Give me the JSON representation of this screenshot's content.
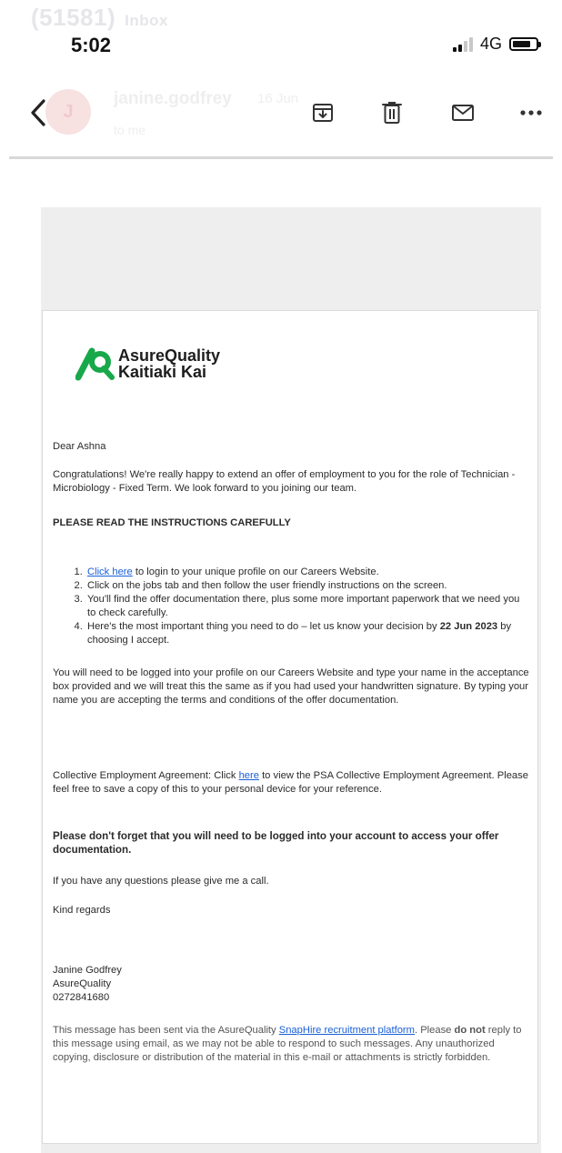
{
  "background_header": {
    "inbox_count": "(51581)",
    "inbox_label": "Inbox",
    "sender_initials": "J",
    "sender_name": "janine.godfrey",
    "date": "16 Jun",
    "to_line": "to me"
  },
  "status_bar": {
    "time": "5:02",
    "network": "4G"
  },
  "toolbar": {
    "back_icon": "chevron-left-icon",
    "archive_icon": "archive-icon",
    "delete_icon": "trash-icon",
    "mark_unread_icon": "envelope-icon",
    "more_icon": "ellipsis-icon"
  },
  "email": {
    "logo_line1": "AsureQuality",
    "logo_line2": "Kaitiaki Kai",
    "greeting": "Dear Ashna",
    "intro": "Congratulations! We're really happy to extend an offer of employment to you for the role of Technician - Microbiology - Fixed Term. We look forward to you joining our team.",
    "instructions_heading": "PLEASE READ THE INSTRUCTIONS CAREFULLY",
    "steps": {
      "s1_link": "Click here",
      "s1_rest": " to login to your unique profile on our Careers Website.",
      "s2": "Click on the jobs tab and then follow the user friendly instructions on the screen.",
      "s3": "You'll find the offer documentation there, plus some more important paperwork that we need you to check carefully.",
      "s4_pre": "Here's the most important thing you need to do – let us know your decision by ",
      "s4_date": "22 Jun 2023",
      "s4_post": " by choosing I accept."
    },
    "acceptance_para": "You will need to be logged into your profile on our Careers Website and type your name in the acceptance box provided and we will treat this the same as if you had used your handwritten signature. By typing your name you are accepting the terms and conditions of the offer documentation.",
    "cea_pre": "Collective Employment Agreement: Click ",
    "cea_link": "here",
    "cea_post": " to view the PSA Collective Employment Agreement. Please feel free to save a copy of this to your personal device for your reference.",
    "reminder": "Please don't forget that you will need to be logged into your account to access your offer documentation.",
    "questions": "If you have any questions please give me a call.",
    "closing": "Kind regards",
    "sig_name": "Janine Godfrey",
    "sig_company": "AsureQuality",
    "sig_phone": "0272841680",
    "footer_pre": "This message has been sent via the AsureQuality ",
    "footer_link": "SnapHire recruitment platform",
    "footer_mid": ". Please ",
    "footer_bold": "do not",
    "footer_post": " reply to this message using email, as we may not be able to respond to such messages. Any unauthorized copying, disclosure or distribution of the material in this e-mail or attachments is strictly forbidden."
  },
  "colors": {
    "logo_green": "#18a84a",
    "link_blue": "#1a5fd8",
    "ghost_red": "#f7e1e1"
  }
}
